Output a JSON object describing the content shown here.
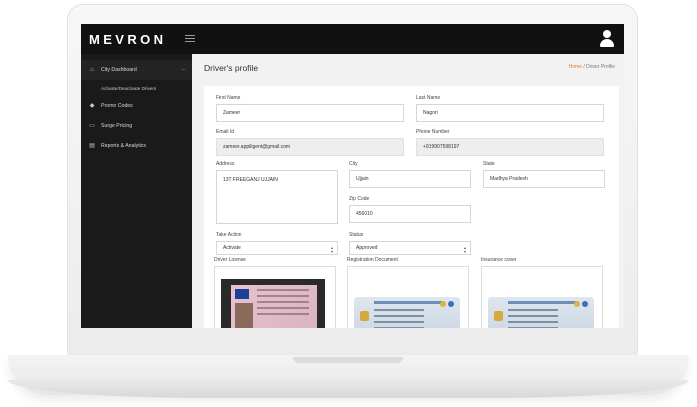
{
  "brand": "MEVRON",
  "sidebar": {
    "items": [
      {
        "label": "City Dashboard",
        "icon": "home-icon"
      },
      {
        "label": "Activate/Deactivate Drivers"
      },
      {
        "label": "Promo Codes",
        "icon": "tag-icon"
      },
      {
        "label": "Surge Pricing",
        "icon": "card-icon"
      },
      {
        "label": "Reports & Analytics",
        "icon": "document-icon"
      }
    ]
  },
  "page": {
    "title": "Driver's profile",
    "breadcrumb_home": "Home",
    "breadcrumb_sep": "/",
    "breadcrumb_current": "Driver Profile"
  },
  "form": {
    "first_name_label": "First Name",
    "first_name": "Zameer",
    "last_name_label": "Last Name",
    "last_name": "Nagori",
    "email_label": "Email Id",
    "email": "zameer.appiligent@gmail.com",
    "phone_label": "Phone Number",
    "phone": "+919907598197",
    "address_label": "Address",
    "address": "13T FREEGANJ UJJAIN",
    "city_label": "City",
    "city": "Ujjain",
    "state_label": "State",
    "state": "Madhya Pradesh",
    "zip_label": "Zip Code",
    "zip": "456010",
    "action_label": "Take Action",
    "action": "Activate",
    "status_label": "Status",
    "status": "Approved",
    "license_label": "Driver License",
    "registration_label": "Registration Document",
    "insurance_label": "Insurance cover"
  }
}
